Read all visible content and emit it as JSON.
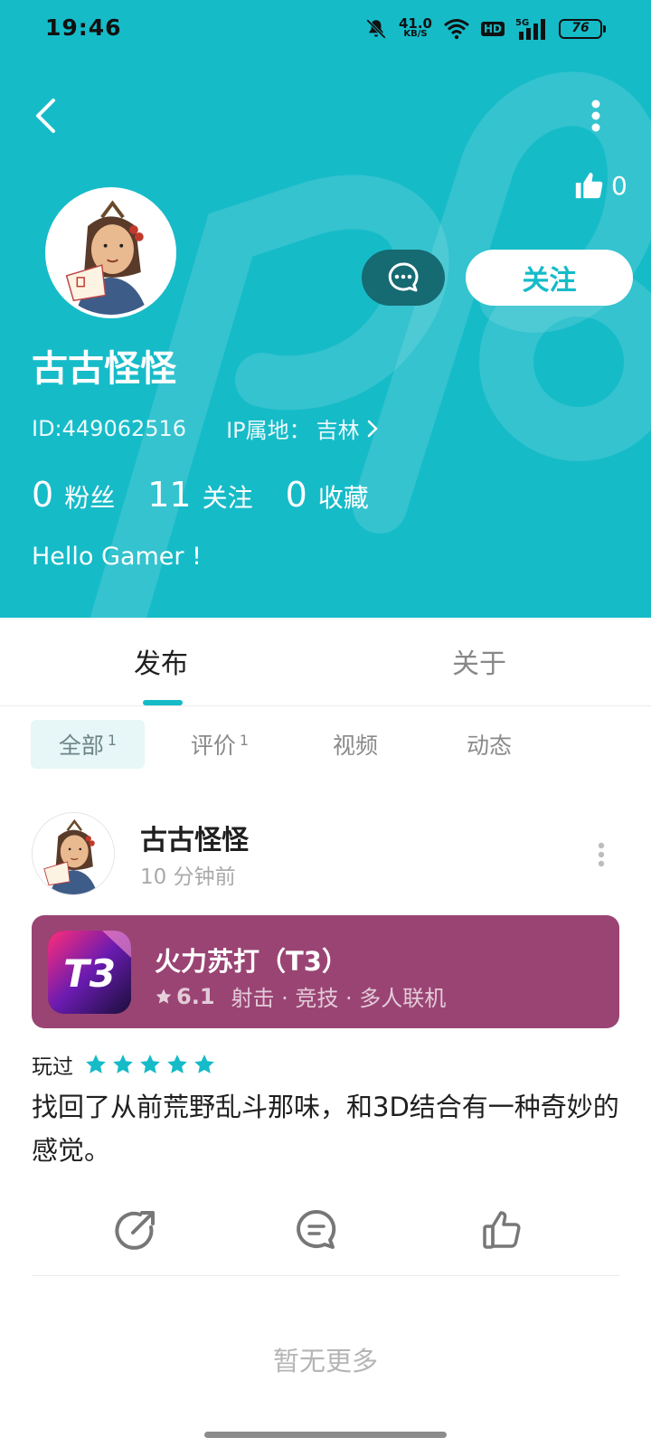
{
  "theme": {
    "accent": "#16bbc8",
    "card_color": "#9a4474",
    "star_color": "#16bbc8"
  },
  "status_bar": {
    "time": "19:46",
    "net_speed": "41.0",
    "net_unit": "KB/S",
    "hd": "HD",
    "signal": "5G",
    "battery": "76"
  },
  "header": {
    "like_count": "0",
    "message_icon": "chat-bubble-icon",
    "follow_label": "关注",
    "nickname": "古古怪怪",
    "id_text": "ID:449062516",
    "ip_label": "IP属地：",
    "ip_value": "吉林",
    "stats": [
      {
        "num": "0",
        "label": "粉丝"
      },
      {
        "num": "11",
        "label": "关注"
      },
      {
        "num": "0",
        "label": "收藏"
      }
    ],
    "bio": "Hello Gamer !"
  },
  "tabs": [
    {
      "label": "发布"
    },
    {
      "label": "关于"
    }
  ],
  "sub_tabs": [
    {
      "label": "全部",
      "count": "1"
    },
    {
      "label": "评价",
      "count": "1"
    },
    {
      "label": "视频",
      "count": ""
    },
    {
      "label": "动态",
      "count": ""
    }
  ],
  "post": {
    "author": "古古怪怪",
    "time": "10 分钟前",
    "game": {
      "title": "火力苏打（T3）",
      "icon_text": "T3",
      "rating": "6.1",
      "tags": "射击 · 竞技 · 多人联机"
    },
    "played_label": "玩过",
    "stars": 5,
    "text": "找回了从前荒野乱斗那味，和3D结合有一种奇妙的感觉。"
  },
  "footer": {
    "no_more": "暂无更多"
  }
}
